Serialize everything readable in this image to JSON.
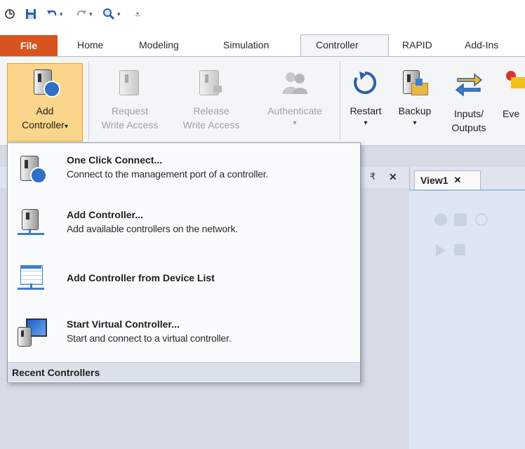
{
  "quick_access": {
    "undo_arrow": "▾",
    "redo_arrow": "▾",
    "find_arrow": "▾",
    "customize": "⩡"
  },
  "tabs": {
    "file": "File",
    "home": "Home",
    "modeling": "Modeling",
    "simulation": "Simulation",
    "controller": "Controller",
    "rapid": "RAPID",
    "addins": "Add-Ins"
  },
  "ribbon": {
    "add_controller": {
      "line1": "Add",
      "line2": "Controller",
      "arrow": "▾"
    },
    "request_write": {
      "line1": "Request",
      "line2": "Write Access"
    },
    "release_write": {
      "line1": "Release",
      "line2": "Write Access"
    },
    "authenticate": {
      "line1": "Authenticate",
      "arrow": "▾"
    },
    "restart": {
      "line1": "Restart",
      "arrow": "▾"
    },
    "backup": {
      "line1": "Backup",
      "arrow": "▾"
    },
    "inputs_outputs": {
      "line1": "Inputs/",
      "line2": "Outputs"
    },
    "events": {
      "line1": "Eve"
    }
  },
  "pane": {
    "pin_symbol": "₹",
    "close_symbol": "✕",
    "view_tab": "View1",
    "view_close": "✕"
  },
  "menu": {
    "items": [
      {
        "title": "One Click Connect...",
        "desc": "Connect to the management port of a controller."
      },
      {
        "title": "Add Controller...",
        "desc": "Add available controllers on the network."
      },
      {
        "title": "Add Controller from Device List",
        "desc": ""
      },
      {
        "title": "Start Virtual Controller...",
        "desc": "Start and connect to a virtual controller."
      }
    ],
    "recent_header": "Recent Controllers"
  },
  "colors": {
    "file_tab": "#d9531e",
    "selected_button": "#fbd58a",
    "accent_blue": "#3a7fcf"
  }
}
